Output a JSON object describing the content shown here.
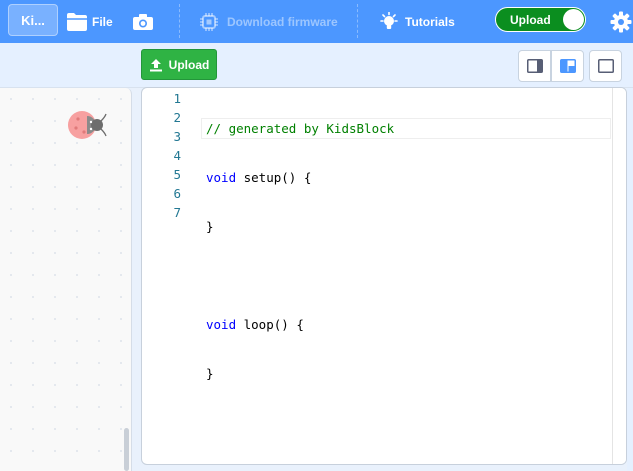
{
  "menubar": {
    "logo_label": "Ki...",
    "file_label": "File",
    "download_label": "Download firmware",
    "tutorials_label": "Tutorials",
    "mode_toggle_label": "Upload"
  },
  "toolbar": {
    "upload_label": "Upload"
  },
  "editor": {
    "line_numbers": [
      "1",
      "2",
      "3",
      "4",
      "5",
      "6",
      "7"
    ],
    "lines": [
      "// generated by KidsBlock",
      "void setup() {",
      "}",
      "",
      "void loop() {",
      "}",
      ""
    ],
    "comment": "// generated by KidsBlock",
    "kw_void": "void",
    "setup_rest": " setup() {",
    "loop_rest": " loop() {",
    "close_brace": "}"
  },
  "colors": {
    "menubar_bg": "#4c97ff",
    "toggle_bg": "#0b8e1f",
    "upload_button_bg": "#2fb344",
    "comment": "#008000",
    "keyword": "#0000ff",
    "line_number": "#237893"
  },
  "icons": {
    "file": "folder-icon",
    "camera": "camera-icon",
    "download": "chip-icon",
    "tutorials": "lightbulb-icon",
    "settings": "gear-icon",
    "upload": "upload-arrow-icon",
    "sprite": "ladybug-icon"
  }
}
